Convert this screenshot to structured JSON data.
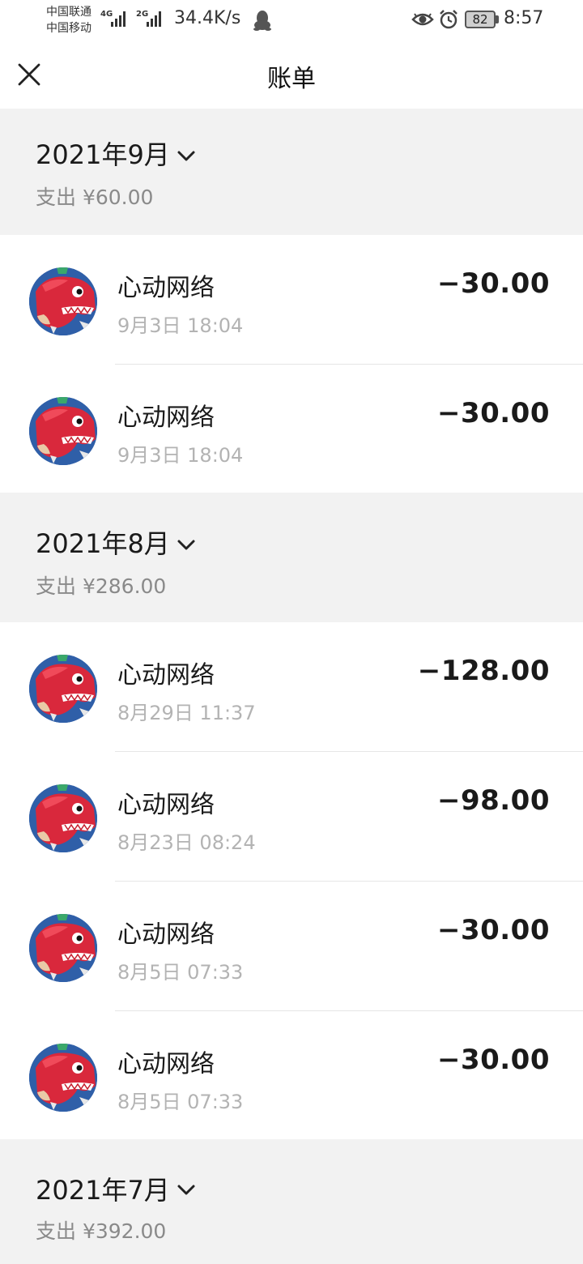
{
  "status_bar": {
    "carrier_1": "中国联通",
    "carrier_2": "中国移动",
    "signal_1_tag": "4G",
    "signal_2_tag": "2G",
    "network_speed": "34.4K/s",
    "battery_level": "82",
    "time": "8:57"
  },
  "header": {
    "title": "账单"
  },
  "months": [
    {
      "label": "2021年9月",
      "spend": "支出 ¥60.00",
      "transactions": [
        {
          "merchant": "心动网络",
          "time": "9月3日 18:04",
          "amount": "−30.00"
        },
        {
          "merchant": "心动网络",
          "time": "9月3日 18:04",
          "amount": "−30.00"
        }
      ]
    },
    {
      "label": "2021年8月",
      "spend": "支出 ¥286.00",
      "transactions": [
        {
          "merchant": "心动网络",
          "time": "8月29日 11:37",
          "amount": "−128.00"
        },
        {
          "merchant": "心动网络",
          "time": "8月23日 08:24",
          "amount": "−98.00"
        },
        {
          "merchant": "心动网络",
          "time": "8月5日 07:33",
          "amount": "−30.00"
        },
        {
          "merchant": "心动网络",
          "time": "8月5日 07:33",
          "amount": "−30.00"
        }
      ]
    },
    {
      "label": "2021年7月",
      "spend": "支出 ¥392.00",
      "transactions": []
    }
  ],
  "icons": {
    "close": "close-icon",
    "chevron": "chevron-down-icon",
    "avatar": "red-dinosaur-avatar"
  },
  "colors": {
    "section_bg": "#f2f2f2",
    "muted_text": "#8a8a8a",
    "time_text": "#b3b3b3",
    "avatar_bg": "#2f5fa8",
    "avatar_red": "#d9283c"
  }
}
